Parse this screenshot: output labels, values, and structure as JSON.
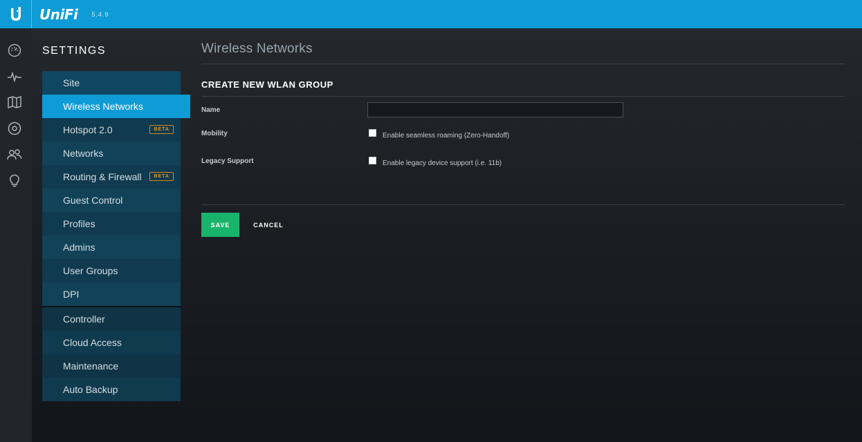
{
  "app": {
    "logo_icon": "ubiquiti-u-icon",
    "name": "UniFi",
    "version": "5.4.9",
    "brand_color": "#0e9bd6"
  },
  "rail": {
    "icons": [
      "dashboard-icon",
      "statistics-icon",
      "map-icon",
      "devices-icon",
      "clients-icon",
      "insights-icon"
    ]
  },
  "settings": {
    "title": "SETTINGS",
    "primary_items": [
      {
        "label": "Site",
        "badge": ""
      },
      {
        "label": "Wireless Networks",
        "badge": "",
        "active": true
      },
      {
        "label": "Hotspot 2.0",
        "badge": "BETA"
      },
      {
        "label": "Networks",
        "badge": ""
      },
      {
        "label": "Routing & Firewall",
        "badge": "BETA"
      },
      {
        "label": "Guest Control",
        "badge": ""
      },
      {
        "label": "Profiles",
        "badge": ""
      },
      {
        "label": "Admins",
        "badge": ""
      },
      {
        "label": "User Groups",
        "badge": ""
      },
      {
        "label": "DPI",
        "badge": ""
      }
    ],
    "secondary_items": [
      {
        "label": "Controller"
      },
      {
        "label": "Cloud Access"
      },
      {
        "label": "Maintenance"
      },
      {
        "label": "Auto Backup"
      }
    ]
  },
  "main": {
    "page_title": "Wireless Networks",
    "section_title": "CREATE NEW WLAN GROUP",
    "name_label": "Name",
    "name_value": "",
    "mobility_label": "Mobility",
    "mobility_option": "Enable seamless roaming (Zero-Handoff)",
    "legacy_label": "Legacy Support",
    "legacy_option": "Enable legacy device support (i.e. 11b)",
    "save_label": "SAVE",
    "cancel_label": "CANCEL",
    "save_color": "#19b46b"
  }
}
